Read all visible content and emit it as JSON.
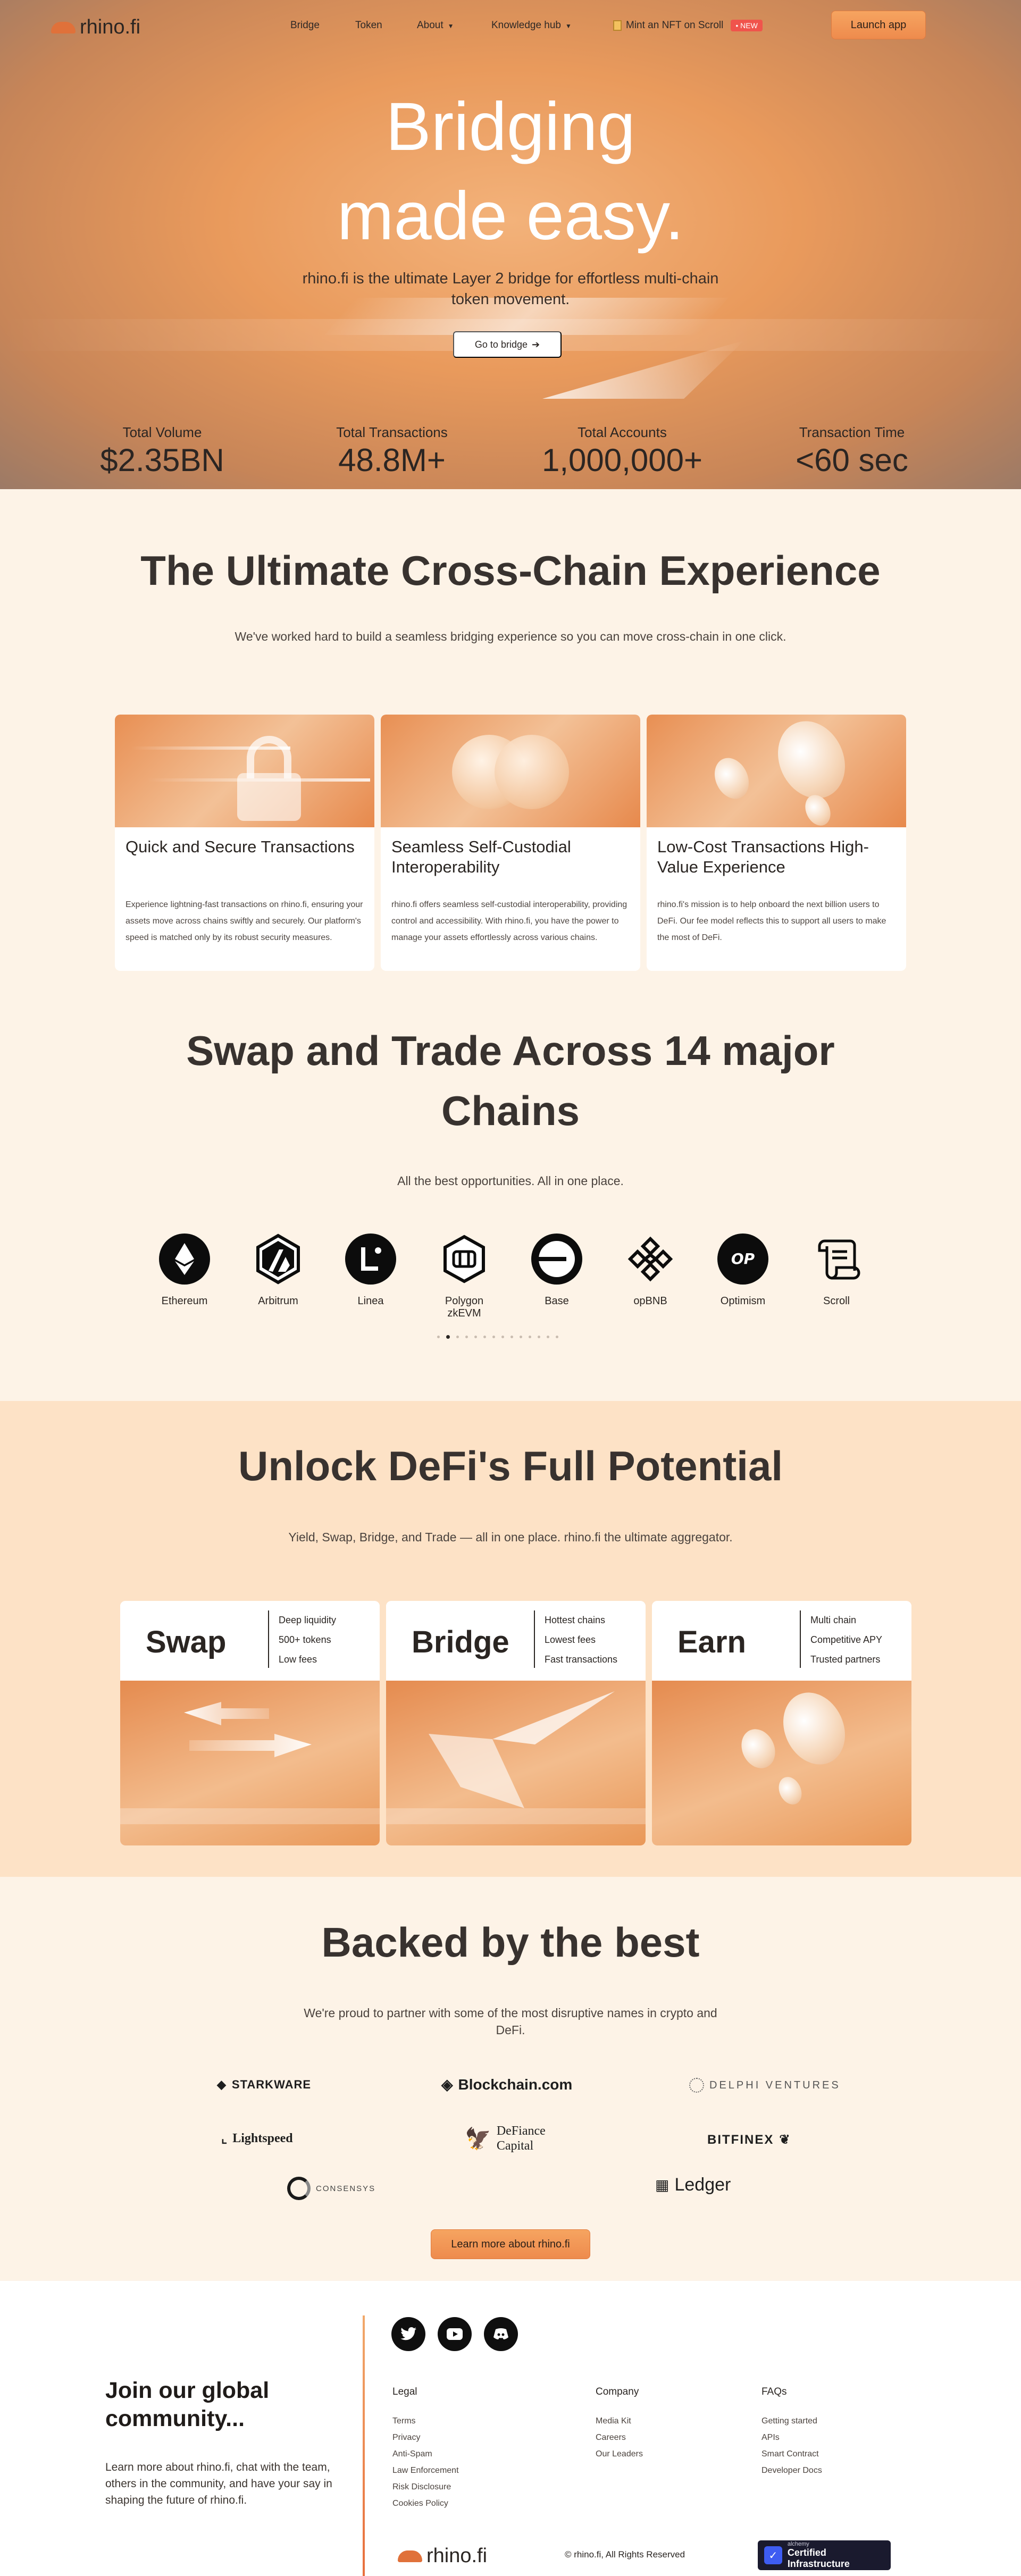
{
  "nav": {
    "brand": "rhino.fi",
    "items": [
      {
        "label": "Bridge"
      },
      {
        "label": "Token"
      },
      {
        "label": "About"
      },
      {
        "label": "Knowledge hub"
      }
    ],
    "nft": {
      "label": "Mint an NFT on Scroll",
      "badge": "• NEW"
    },
    "launch_label": "Launch app"
  },
  "hero": {
    "title_line1": "Bridging",
    "title_line2": "made easy.",
    "subtitle": "rhino.fi is the ultimate Layer 2 bridge for effortless multi-chain token movement.",
    "cta": "Go to bridge",
    "stats": [
      {
        "label": "Total Volume",
        "value": "$2.35BN"
      },
      {
        "label": "Total Transactions",
        "value": "48.8M+"
      },
      {
        "label": "Total Accounts",
        "value": "1,000,000+"
      },
      {
        "label": "Transaction Time",
        "value": "<60 sec"
      }
    ]
  },
  "experience": {
    "title": "The Ultimate Cross-Chain Experience",
    "subtitle": "We've worked hard to build a seamless bridging experience so you can move cross-chain in one click.",
    "cards": [
      {
        "title": "Quick and Secure Transactions",
        "body": "Experience lightning-fast transactions on rhino.fi, ensuring your assets move across chains swiftly and securely. Our platform's speed is matched only by its robust security measures."
      },
      {
        "title": "Seamless Self-Custodial Interoperability",
        "body": "rhino.fi offers seamless self-custodial interoperability, providing control and accessibility. With rhino.fi, you have the power to manage your assets effortlessly across various chains."
      },
      {
        "title": "Low-Cost Transactions High-Value Experience",
        "body": "rhino.fi's mission is to help onboard the next billion users to DeFi. Our fee model reflects this to support all users to make the most of DeFi."
      }
    ]
  },
  "chains": {
    "title": "Swap and Trade Across 14 major Chains",
    "subtitle": "All the best opportunities. All in one place.",
    "items": [
      {
        "name": "Ethereum",
        "icon": "ethereum-icon"
      },
      {
        "name": "Arbitrum",
        "icon": "arbitrum-icon"
      },
      {
        "name": "Linea",
        "icon": "linea-icon"
      },
      {
        "name": "Polygon zkEVM",
        "icon": "polygon-zkevm-icon"
      },
      {
        "name": "Base",
        "icon": "base-icon"
      },
      {
        "name": "opBNB",
        "icon": "opbnb-icon"
      },
      {
        "name": "Optimism",
        "icon": "optimism-icon",
        "short": "OP"
      },
      {
        "name": "Scroll",
        "icon": "scroll-icon"
      }
    ],
    "pagination": {
      "active": 1,
      "total": 14
    }
  },
  "defi": {
    "title": "Unlock DeFi's Full Potential",
    "subtitle": "Yield, Swap, Bridge, and Trade — all in one place. rhino.fi the ultimate aggregator.",
    "products": [
      {
        "title": "Swap",
        "features": [
          "Deep liquidity",
          "500+ tokens",
          "Low fees"
        ]
      },
      {
        "title": "Bridge",
        "features": [
          "Hottest chains",
          "Lowest fees",
          "Fast transactions"
        ]
      },
      {
        "title": "Earn",
        "features": [
          "Multi chain",
          "Competitive APY",
          "Trusted partners"
        ]
      }
    ]
  },
  "backers": {
    "title": "Backed by the best",
    "subtitle": "We're proud to partner with some of the most disruptive names in crypto and DeFi.",
    "partners": [
      "STARKWARE",
      "Blockchain.com",
      "DELPHI VENTURES",
      "Lightspeed",
      "DeFiance Capital",
      "BITFINEX",
      "CONSENSYS",
      "Ledger"
    ],
    "cta": "Learn more about rhino.fi"
  },
  "footer": {
    "join_title": "Join our global community...",
    "join_body": "Learn more about rhino.fi, chat with the team, others in the community, and have your say in shaping the future of rhino.fi.",
    "social": [
      "twitter-icon",
      "youtube-icon",
      "discord-icon"
    ],
    "columns": [
      {
        "heading": "Legal",
        "links": [
          "Terms",
          "Privacy",
          "Anti-Spam",
          "Law Enforcement",
          "Risk Disclosure",
          "Cookies Policy"
        ]
      },
      {
        "heading": "Company",
        "links": [
          "Media Kit",
          "Careers",
          "Our Leaders"
        ]
      },
      {
        "heading": "FAQs",
        "links": [
          "Getting started",
          "APIs",
          "Smart Contract",
          "Developer Docs"
        ]
      }
    ],
    "brand": "rhino.fi",
    "copyright": "© rhino.fi, All Rights Reserved",
    "badge_small": "alchemy",
    "badge_big": "Certified Infrastructure"
  },
  "colors": {
    "accent": "#ee8b4d",
    "hero_center": "#f3b27a",
    "dark": "#2a2522"
  }
}
